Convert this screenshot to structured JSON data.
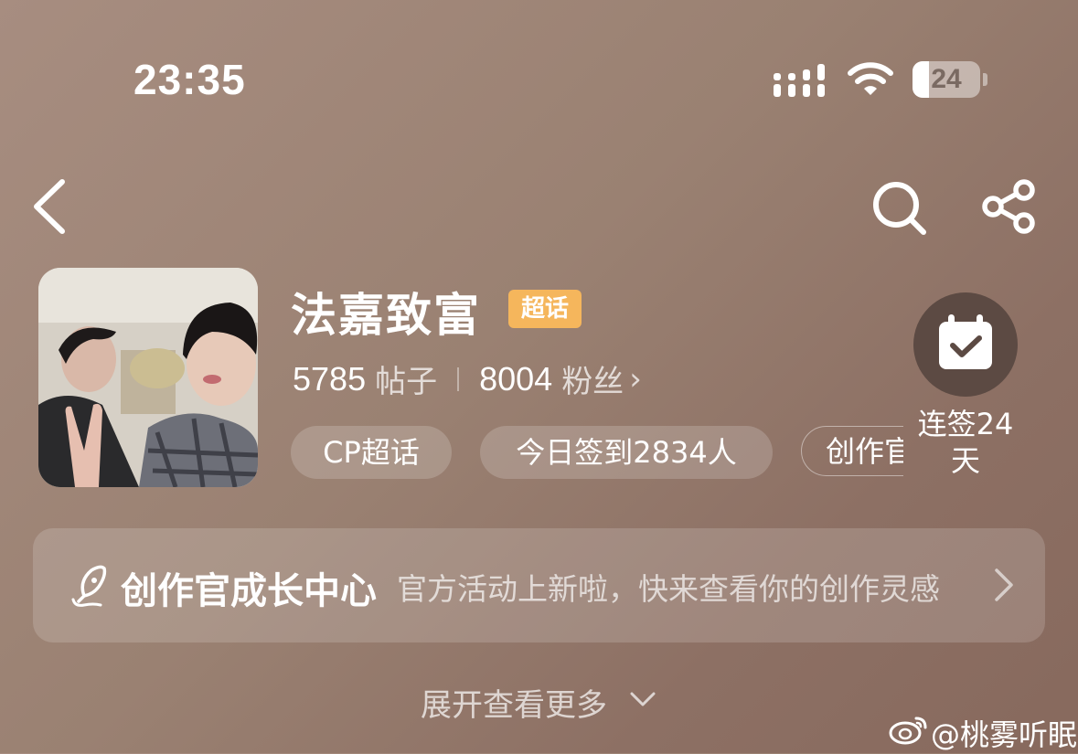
{
  "status_bar": {
    "time": "23:35",
    "battery_level": "24",
    "battery_fraction": 0.24,
    "icons": [
      "cellular-signal-icon",
      "wifi-icon",
      "battery-icon"
    ]
  },
  "nav": {
    "icons": [
      "back-chevron-icon",
      "search-icon",
      "share-icon"
    ]
  },
  "profile": {
    "name": "法嘉致富",
    "badge": "超话",
    "posts_count": "5785",
    "posts_label": "帖子",
    "fans_count": "8004",
    "fans_label": "粉丝",
    "fans_chevron": "›",
    "tags": [
      "CP超话",
      "今日签到2834人",
      "创作官"
    ]
  },
  "checkin": {
    "label": "连签24天"
  },
  "creator_panel": {
    "title": "创作官成长中心",
    "subtitle": "官方活动上新啦，快来查看你的创作灵感"
  },
  "expand": {
    "label": "展开查看更多"
  },
  "watermark": {
    "text": "@桃雾听眠"
  },
  "colors": {
    "background": "#9a8172",
    "badge": "#f5b65c",
    "checkin_circle": "#5c4a43"
  }
}
